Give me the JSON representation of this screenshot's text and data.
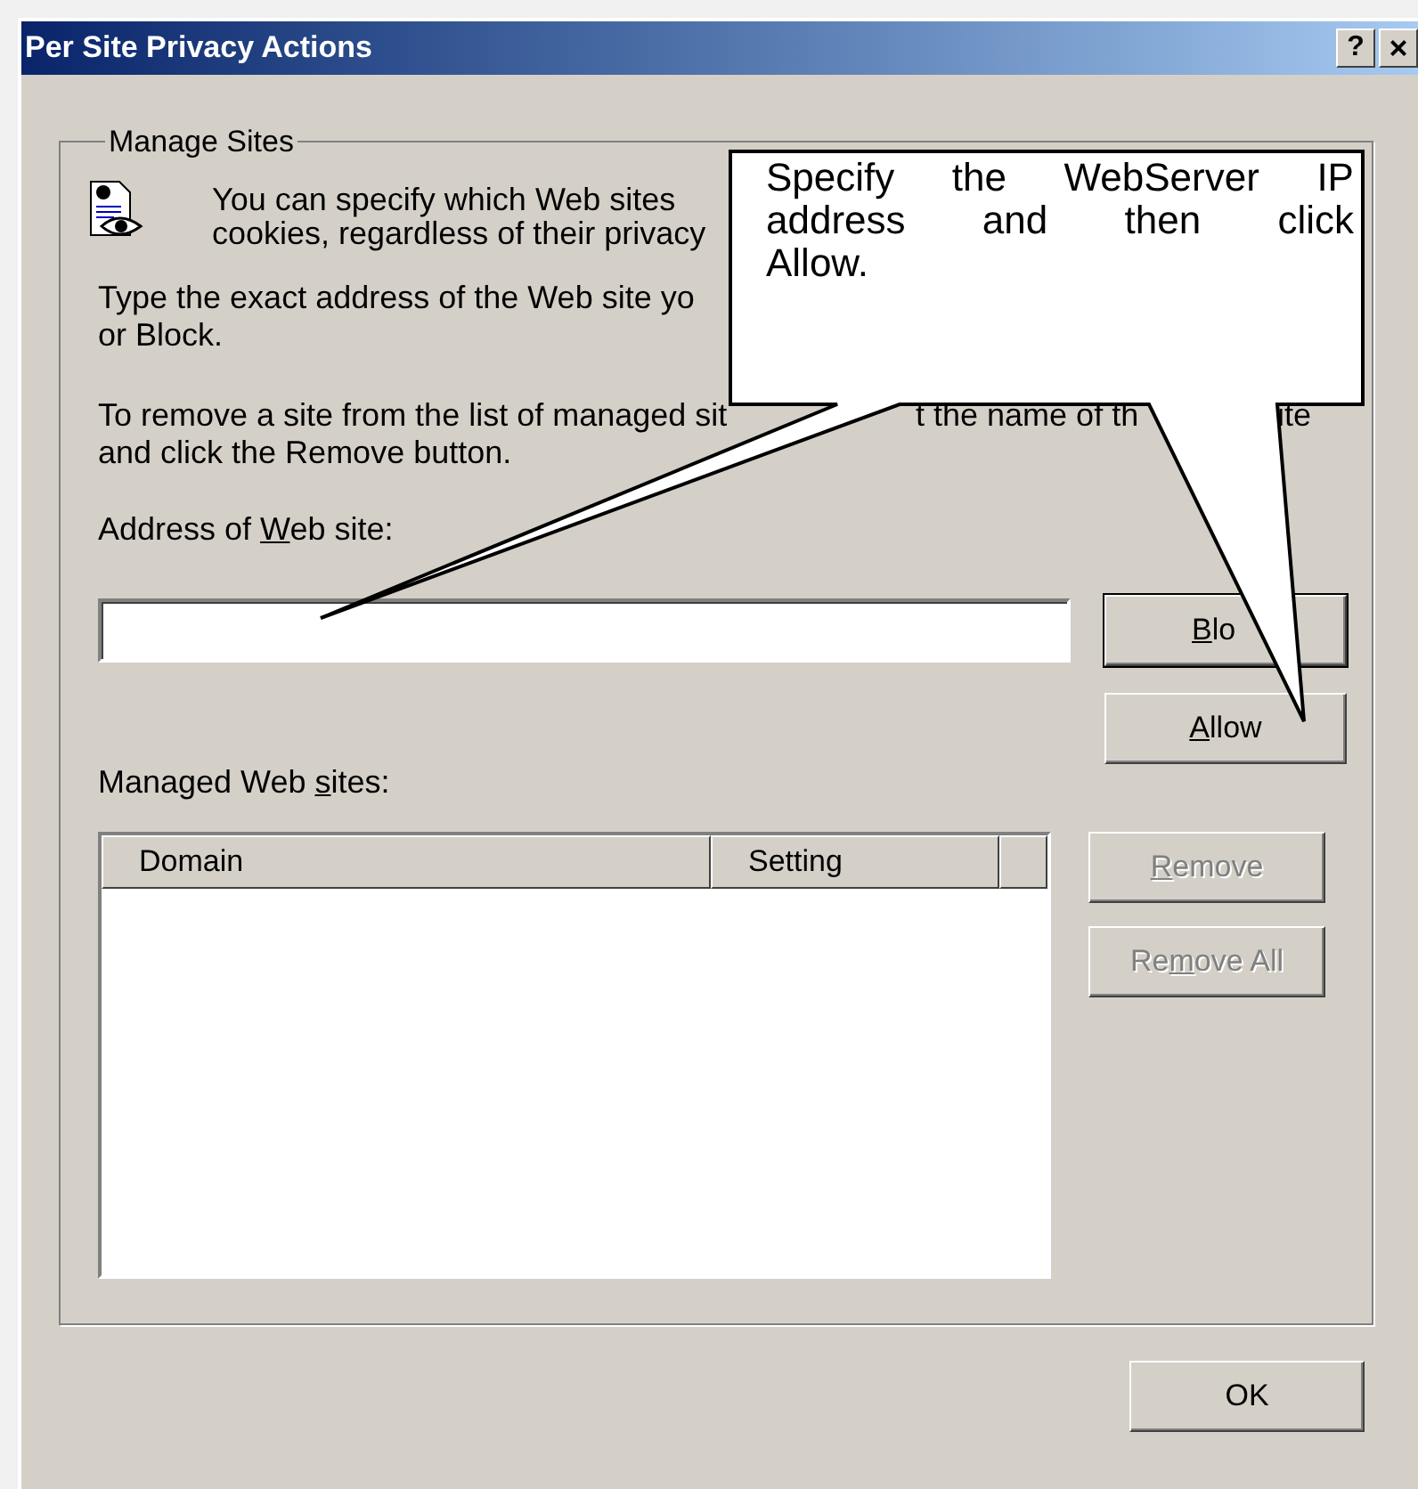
{
  "window": {
    "title": "Per Site Privacy Actions",
    "help_button": "?",
    "close_button": "×"
  },
  "manage_sites": {
    "legend": "Manage Sites",
    "intro_lines": [
      "You can specify which Web sites",
      "cookies, regardless of their privacy"
    ],
    "type_lines": [
      "Type the exact address of the Web site yo",
      "or Block."
    ],
    "remove_line_fragments": [
      "To remove a site from the list of managed sit",
      "t the name of th",
      "ite"
    ],
    "remove_line_2": "and click the Remove button.",
    "address_label": {
      "before": "Address of ",
      "key": "W",
      "after": "eb site:"
    },
    "block_button": {
      "label": {
        "key": "B",
        "after": "lo"
      },
      "default": true,
      "disabled": false
    },
    "allow_button": {
      "label": {
        "key": "A",
        "after": "llow"
      },
      "default": false,
      "disabled": false
    },
    "managed_label": {
      "before": "Managed Web ",
      "key": "s",
      "after": "ites:"
    },
    "table": {
      "columns": [
        "Domain",
        "Setting"
      ]
    },
    "remove_buttons": [
      {
        "label": {
          "key": "R",
          "after": "emove"
        },
        "disabled": true
      },
      {
        "label": {
          "before": "Re",
          "key": "m",
          "after": "ove All"
        },
        "disabled": true
      }
    ]
  },
  "ok_button": "OK",
  "callout": {
    "lines": [
      "Specify the WebServer IP",
      "address and then click",
      "Allow."
    ]
  }
}
